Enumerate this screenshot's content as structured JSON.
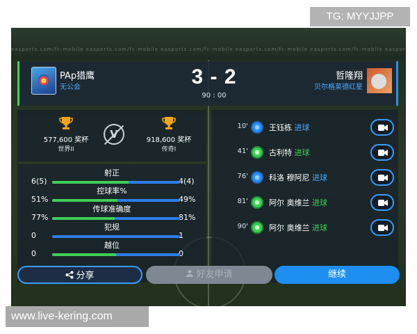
{
  "watermark": {
    "top": "TG: MYYJJPP",
    "bottom": "www.live-kering.com"
  },
  "stadium": {
    "ad_text": "easports.com/fc-mobile    easports.com/fc-mobile    easports.com/fc-mobile    easports.com/fc-mobile    easports.com/fc-mobile    easports.com/fc-mobile"
  },
  "match": {
    "home": {
      "name": "PAp猎鹰",
      "club": "无公会",
      "crest_icon": "shield-crest-icon"
    },
    "away": {
      "name": "哲隆翔",
      "club": "贝尔格莱德红星",
      "avatar_icon": "player-avatar-icon"
    },
    "score": "3 - 2",
    "time": "90 : 00"
  },
  "rank": {
    "home": {
      "cup": "577,600 奖杯",
      "level": "世界II"
    },
    "vs_label": "V",
    "away": {
      "cup": "918,600 奖杯",
      "level": "传奇I"
    }
  },
  "stats": [
    {
      "label": "射正",
      "home": "6(5)",
      "away": "4(4)",
      "home_share": 0.6
    },
    {
      "label": "控球率%",
      "home": "51%",
      "away": "49%",
      "home_share": 0.51
    },
    {
      "label": "传球准确度",
      "home": "77%",
      "away": "81%",
      "home_share": 0.49
    },
    {
      "label": "犯规",
      "home": "0",
      "away": "1",
      "home_share": 0.0
    },
    {
      "label": "越位",
      "home": "0",
      "away": "0",
      "home_share": 0.5
    }
  ],
  "events": [
    {
      "minute": "10'",
      "player": "王钰栋",
      "type": "进球",
      "team": "away",
      "ball_color": "#2c8ff0"
    },
    {
      "minute": "41'",
      "player": "古利特",
      "type": "进球",
      "team": "home",
      "ball_color": "#3fcf58"
    },
    {
      "minute": "76'",
      "player": "科洛 穆阿尼",
      "type": "进球",
      "team": "away",
      "ball_color": "#2c8ff0"
    },
    {
      "minute": "81'",
      "player": "阿尔 奥维兰",
      "type": "进球",
      "team": "home",
      "ball_color": "#3fcf58"
    },
    {
      "minute": "90'",
      "player": "阿尔 奥维兰",
      "type": "进球",
      "team": "home",
      "ball_color": "#3fcf58"
    }
  ],
  "buttons": {
    "share": "分享",
    "friend_request": "好友申请",
    "continue": "继续"
  },
  "colors": {
    "home": "#3fcf58",
    "away": "#2c8ff0",
    "accent": "#1e8ef0"
  }
}
